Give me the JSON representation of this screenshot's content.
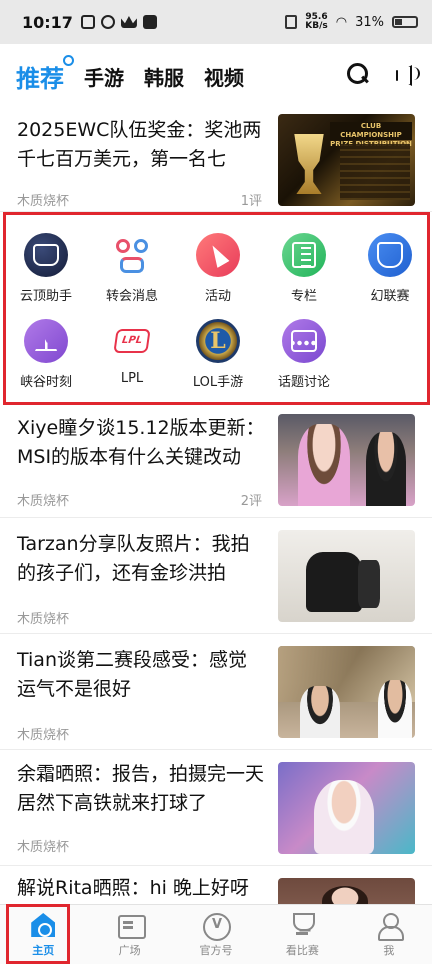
{
  "status_bar": {
    "time": "10:17",
    "net_speed": "95.6",
    "net_unit": "KB/s",
    "battery": "31%",
    "icons": [
      "notification-icon",
      "app-icon",
      "crown-icon",
      "tiktok-icon"
    ]
  },
  "header": {
    "tabs": [
      {
        "label": "推荐",
        "active": true
      },
      {
        "label": "手游",
        "active": false
      },
      {
        "label": "韩服",
        "active": false
      },
      {
        "label": "视频",
        "active": false
      }
    ],
    "actions": [
      "search-icon",
      "speaker-icon"
    ]
  },
  "news": [
    {
      "title": "2025EWC队伍奖金：奖池两千七百万美元，第一名七",
      "author": "木质烧杯",
      "comments": "1评",
      "thumb_text": "CLUB CHAMPIONSHIP PRIZE DISTRIBUTION"
    },
    {
      "title": "Xiye瞳夕谈15.12版本更新：MSI的版本有什么关键改动",
      "author": "木质烧杯",
      "comments": "2评"
    },
    {
      "title": "Tarzan分享队友照片：我拍的孩子们，还有金珍洪拍",
      "author": "木质烧杯",
      "comments": ""
    },
    {
      "title": "Tian谈第二赛段感受：感觉运气不是很好",
      "author": "木质烧杯",
      "comments": ""
    },
    {
      "title": "余霜晒照：报告，拍摄完一天居然下高铁就来打球了",
      "author": "木质烧杯",
      "comments": ""
    },
    {
      "title": "解说Rita晒照：hi 晚上好呀",
      "author": "",
      "comments": ""
    }
  ],
  "quick_entries": [
    {
      "label": "云顶助手",
      "icon": "yunding-icon"
    },
    {
      "label": "转会消息",
      "icon": "transfer-icon"
    },
    {
      "label": "活动",
      "icon": "party-icon"
    },
    {
      "label": "专栏",
      "icon": "column-icon"
    },
    {
      "label": "幻联赛",
      "icon": "fantasy-league-icon"
    },
    {
      "label": "峡谷时刻",
      "icon": "canyon-moment-icon"
    },
    {
      "label": "LPL",
      "icon": "lpl-icon"
    },
    {
      "label": "LOL手游",
      "icon": "lol-mobile-icon"
    },
    {
      "label": "话题讨论",
      "icon": "topic-icon"
    }
  ],
  "lpl_badge_text": "LPL",
  "bottom_nav": [
    {
      "label": "主页",
      "icon": "home-icon",
      "active": true
    },
    {
      "label": "广场",
      "icon": "square-icon",
      "active": false
    },
    {
      "label": "官方号",
      "icon": "official-icon",
      "active": false
    },
    {
      "label": "看比赛",
      "icon": "trophy-icon",
      "active": false
    },
    {
      "label": "我",
      "icon": "me-icon",
      "active": false
    }
  ],
  "colors": {
    "accent": "#1a8ee8",
    "highlight_frame": "#e0262e"
  }
}
